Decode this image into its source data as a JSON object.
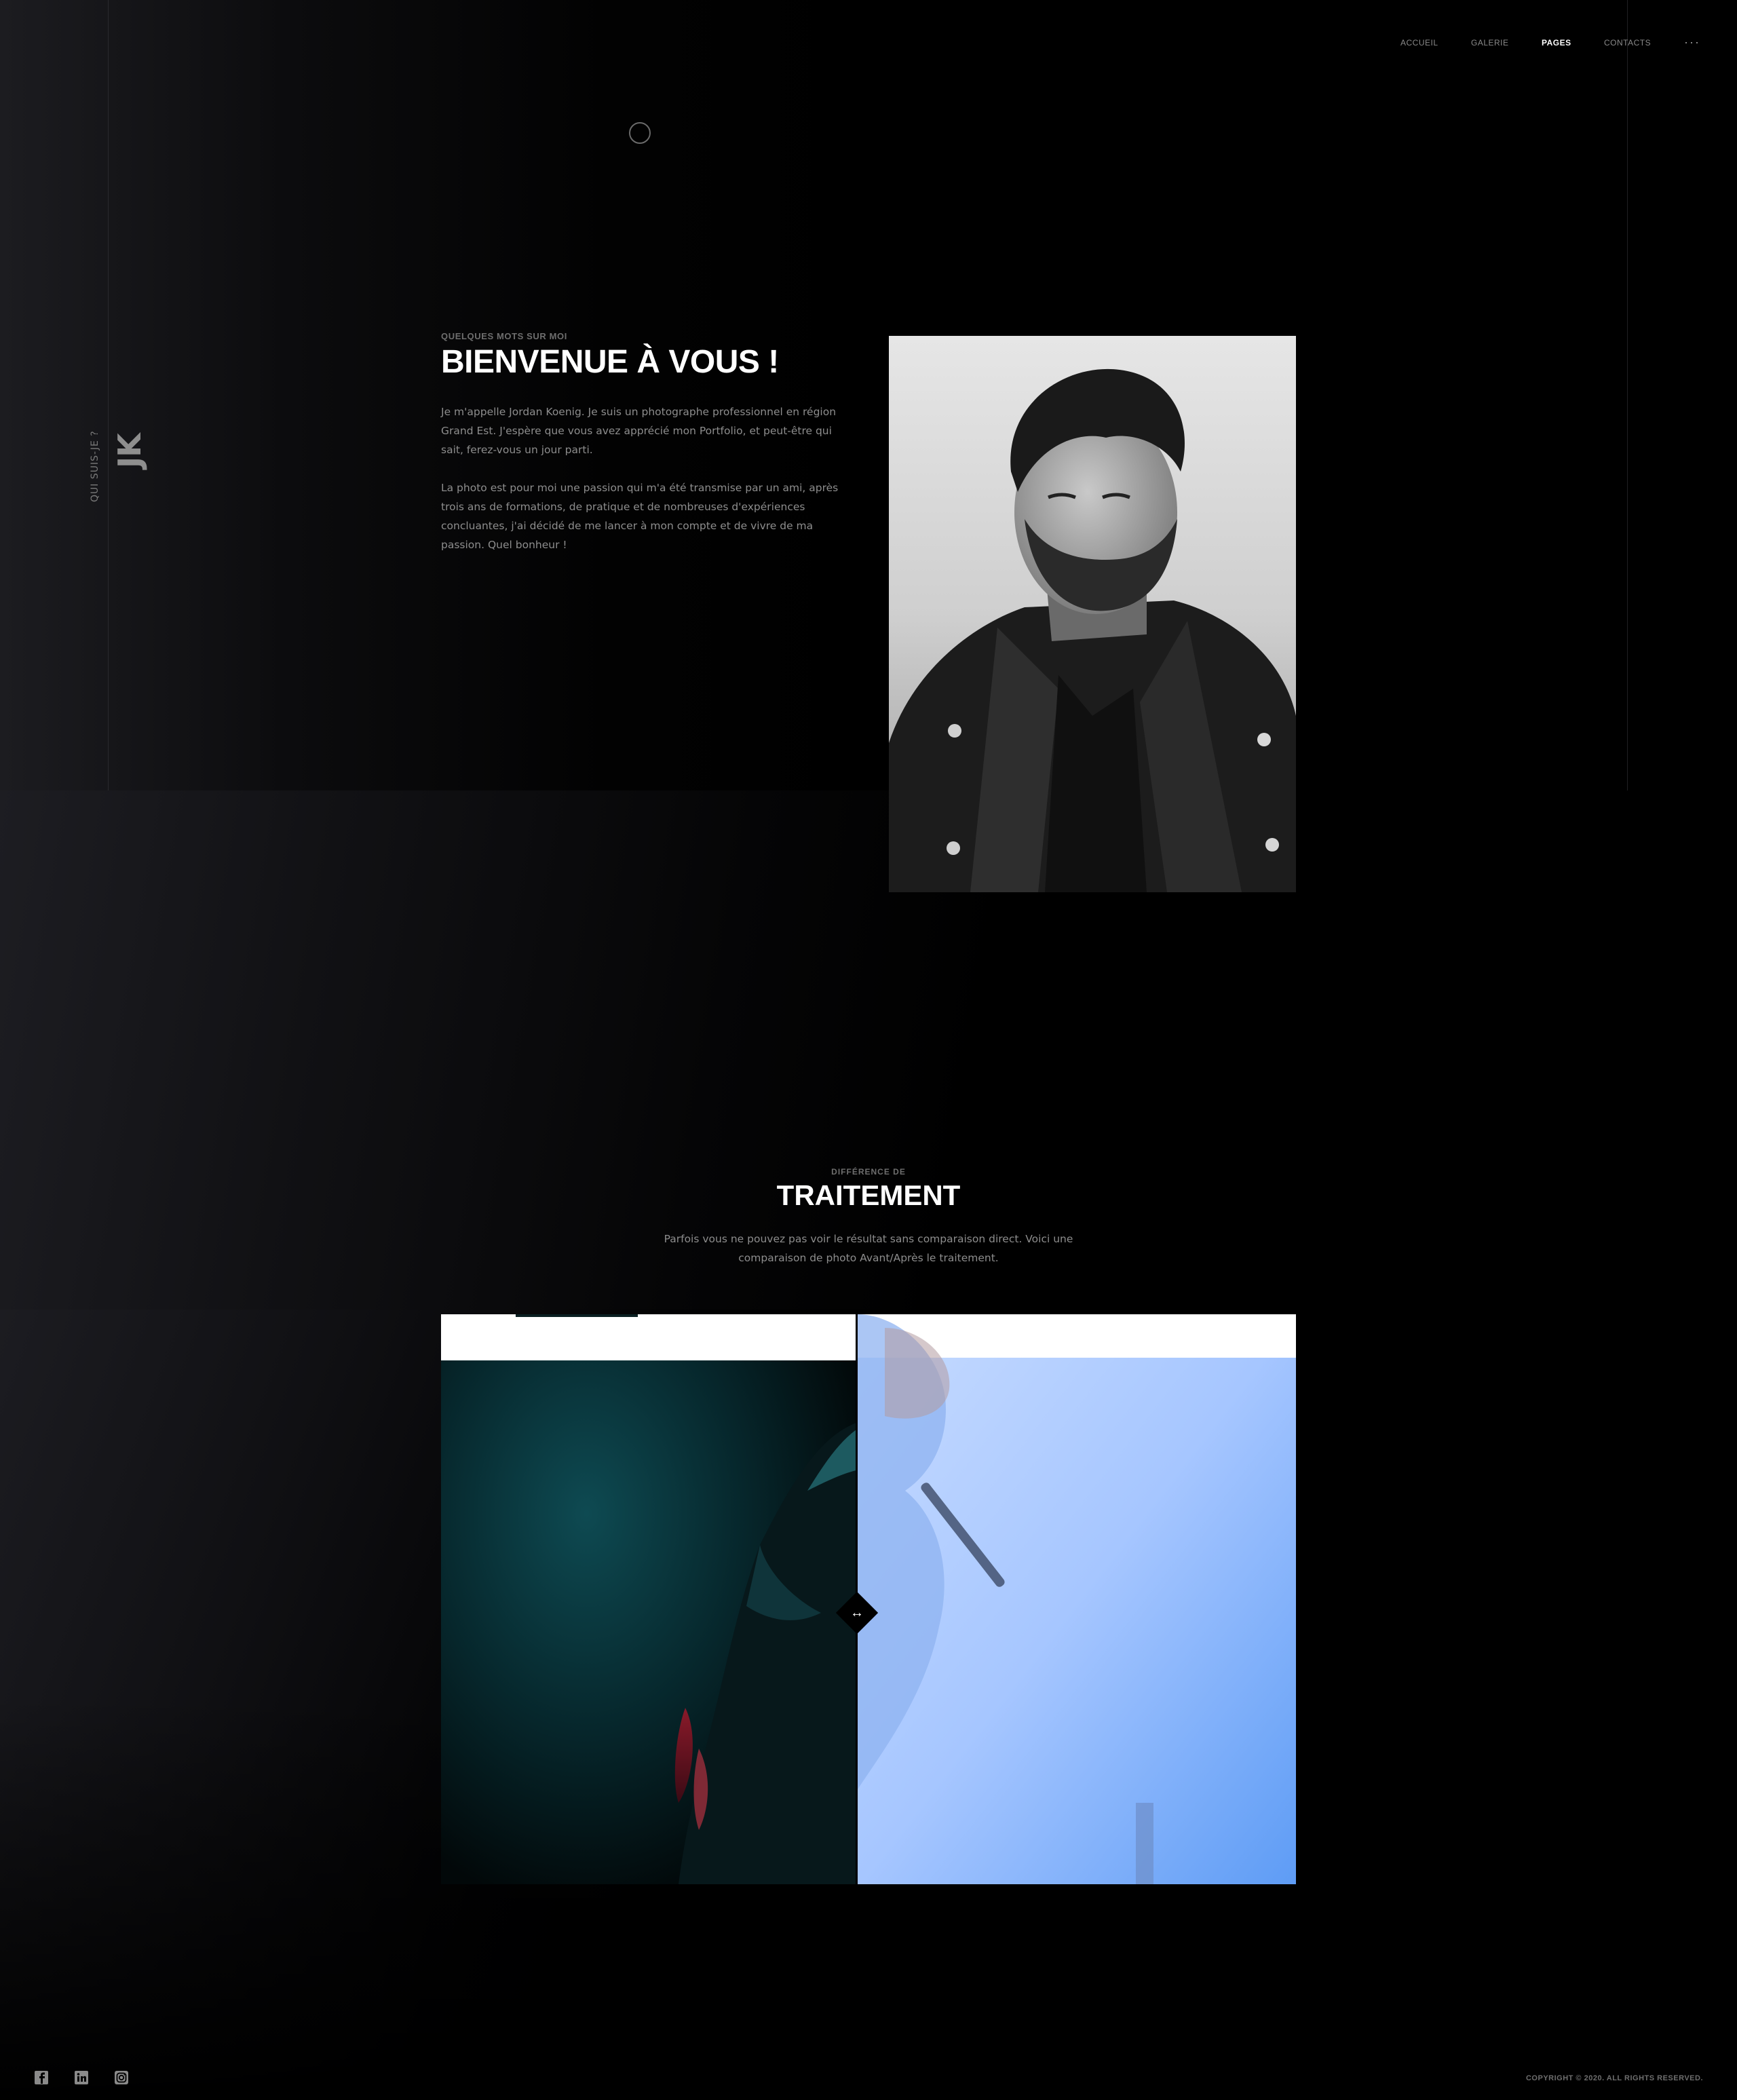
{
  "nav": {
    "items": [
      {
        "label": "ACCUEIL",
        "active": false
      },
      {
        "label": "GALERIE",
        "active": false
      },
      {
        "label": "PAGES",
        "active": true
      },
      {
        "label": "CONTACTS",
        "active": false
      }
    ],
    "more_label": "···"
  },
  "side": {
    "question": "QUI SUIS-JE ?",
    "logo": "JK"
  },
  "about": {
    "eyebrow": "QUELQUES MOTS SUR MOI",
    "title": "BIENVENUE À VOUS !",
    "paragraph1": "Je m'appelle Jordan Koenig. Je suis un photographe professionnel en région Grand Est.  J'espère que vous avez apprécié mon Portfolio, et peut-être qui sait, ferez-vous un jour parti.",
    "paragraph2": "La photo est pour moi une passion qui m'a été transmise par un ami, après trois ans de formations, de pratique et de nombreuses d'expériences concluantes,  j'ai décidé de me lancer à mon compte et de vivre de ma passion. Quel bonheur !"
  },
  "treatment": {
    "eyebrow": "DIFFÉRENCE DE",
    "title": "TRAITEMENT",
    "description": "Parfois vous ne pouvez pas voir le résultat sans comparaison direct. Voici une comparaison de photo Avant/Après le traitement.",
    "slider_position": 0.486
  },
  "footer": {
    "social_icons": [
      "facebook-icon",
      "linkedin-icon",
      "instagram-icon"
    ],
    "copyright": "COPYRIGHT © 2020. ALL RIGHTS RESERVED."
  },
  "colors": {
    "background": "#000000",
    "text_muted": "#8d8d8d",
    "eyebrow": "#6e6e6e",
    "after_photo_blue": "#7fb3ff"
  }
}
